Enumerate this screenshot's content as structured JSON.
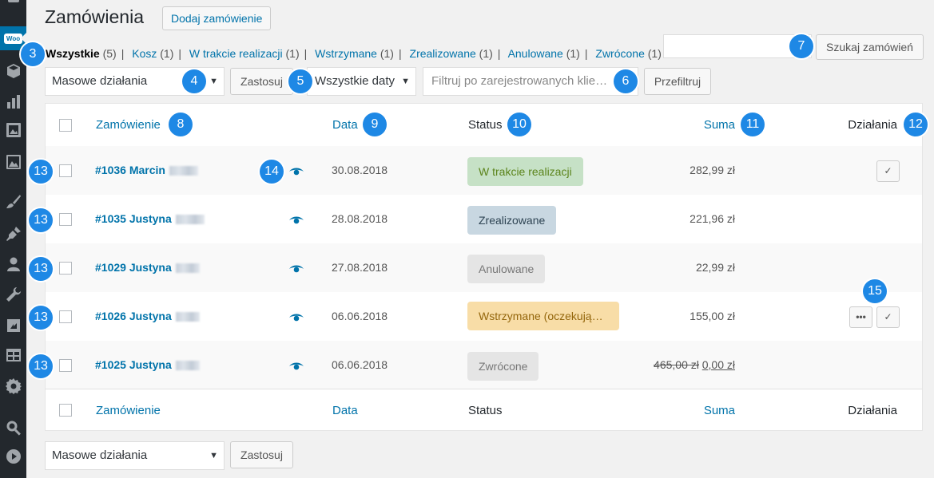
{
  "sidebar": {
    "woo_label": "Woo",
    "icons": [
      "dashboard-icon",
      "woo-icon",
      "box-icon",
      "bar-chart-icon",
      "gallery-icon",
      "image-icon",
      "paintbrush-icon",
      "plugin-icon",
      "user-icon",
      "wrench-icon",
      "import-icon",
      "table-icon",
      "gear-icon",
      "search-icon",
      "play-icon"
    ]
  },
  "header": {
    "title": "Zamówienia",
    "add_button": "Dodaj zamówienie"
  },
  "filters_links": [
    {
      "label": "Wszystkie",
      "count": "(5)",
      "current": true
    },
    {
      "label": "Kosz",
      "count": "(1)"
    },
    {
      "label": "W trakcie realizacji",
      "count": "(1)"
    },
    {
      "label": "Wstrzymane",
      "count": "(1)"
    },
    {
      "label": "Zrealizowane",
      "count": "(1)"
    },
    {
      "label": "Anulowane",
      "count": "(1)"
    },
    {
      "label": "Zwrócone",
      "count": "(1)"
    }
  ],
  "search": {
    "value": "",
    "button": "Szukaj zamówień"
  },
  "toolbar": {
    "bulk_select": "Masowe działania",
    "apply": "Zastosuj",
    "date_select": "Wszystkie daty",
    "customer_placeholder": "Filtruj po zarejestrowanych kliе…",
    "filter_button": "Przefiltruj"
  },
  "columns": {
    "order": "Zamówienie",
    "date": "Data",
    "status": "Status",
    "total": "Suma",
    "actions": "Działania"
  },
  "orders": [
    {
      "title": "#1036 Marcin",
      "date": "30.08.2018",
      "status": "W trakcie realizacji",
      "status_type": "processing",
      "total": "282,99 zł"
    },
    {
      "title": "#1035 Justyna",
      "date": "28.08.2018",
      "status": "Zrealizowane",
      "status_type": "completed",
      "total": "221,96 zł"
    },
    {
      "title": "#1029 Justyna",
      "date": "27.08.2018",
      "status": "Anulowane",
      "status_type": "cancelled",
      "total": "22,99 zł"
    },
    {
      "title": "#1026 Justyna",
      "date": "06.06.2018",
      "status": "Wstrzymane (oczekują…",
      "status_type": "on-hold",
      "total": "155,00 zł"
    },
    {
      "title": "#1025 Justyna",
      "date": "06.06.2018",
      "status": "Zwrócone",
      "status_type": "refunded",
      "total_old": "465,00 zł",
      "total": "0,00 zł"
    }
  ],
  "badges": [
    "3",
    "4",
    "5",
    "6",
    "7",
    "8",
    "9",
    "10",
    "11",
    "12",
    "13",
    "14",
    "15"
  ],
  "colors": {
    "accent": "#0073aa",
    "badge": "#1e88e5",
    "processing_bg": "#c6e1c6",
    "processing_fg": "#5b841b",
    "completed_bg": "#c8d7e1",
    "completed_fg": "#2e4453",
    "cancelled_bg": "#e5e5e5",
    "cancelled_fg": "#777777",
    "onhold_bg": "#f8dda7",
    "onhold_fg": "#94660c",
    "refunded_bg": "#e5e5e5",
    "refunded_fg": "#777777"
  }
}
